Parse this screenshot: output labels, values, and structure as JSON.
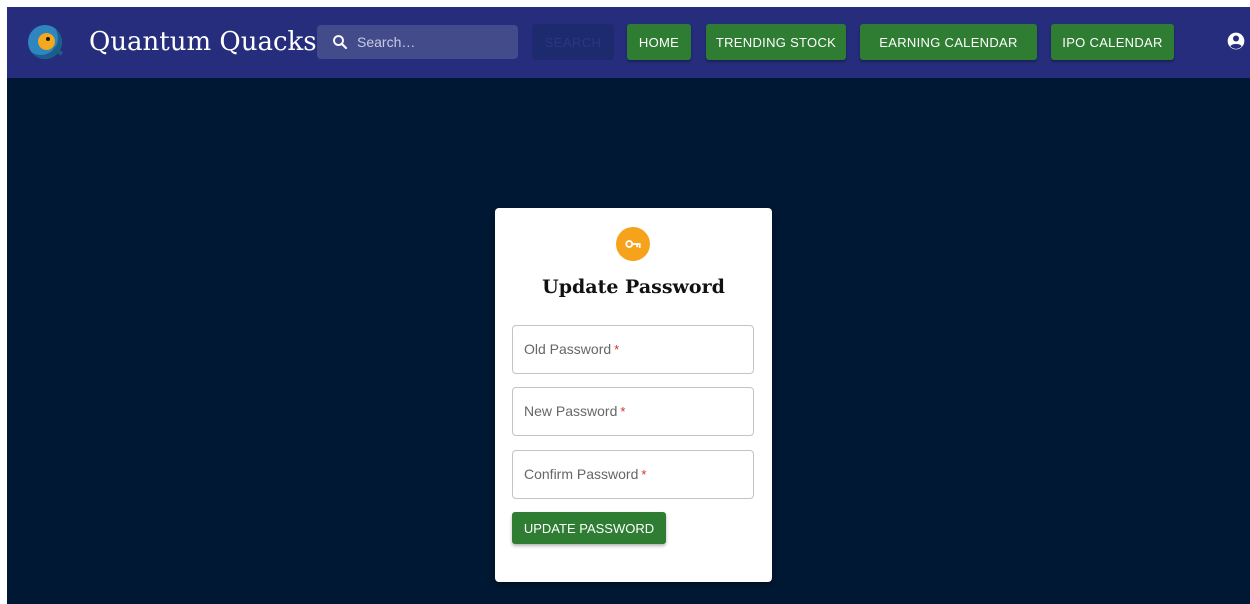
{
  "header": {
    "brand": "Quantum Quacks",
    "search": {
      "placeholder": "Search…",
      "button_label": "SEARCH"
    },
    "nav": {
      "home": "HOME",
      "trending": "TRENDING STOCK",
      "earning": "EARNING CALENDAR",
      "ipo": "IPO CALENDAR"
    }
  },
  "card": {
    "title": "Update Password",
    "fields": {
      "old": "Old Password",
      "new": "New Password",
      "confirm": "Confirm Password"
    },
    "required_mark": "*",
    "submit_label": "UPDATE PASSWORD"
  },
  "colors": {
    "appbar": "#262d7c",
    "background": "#001833",
    "button_green": "#2e7d32",
    "key_badge": "#f7a21b"
  },
  "icons": {
    "logo": "quantum-quacks-logo",
    "search": "search-icon",
    "account": "account-circle-icon",
    "key": "vpn-key-icon"
  }
}
